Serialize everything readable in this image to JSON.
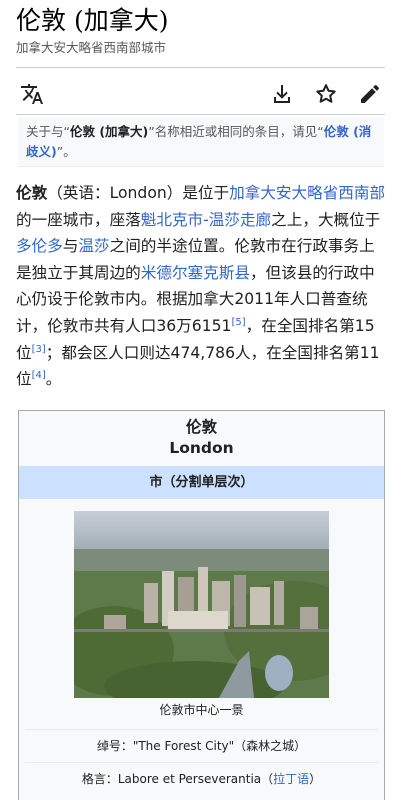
{
  "header": {
    "title": "伦敦 (加拿大)",
    "subtitle": "加拿大安大略省西南部城市"
  },
  "toolbar": {
    "items": [
      {
        "icon": "language-icon"
      },
      {
        "icon": "download-icon"
      },
      {
        "icon": "star-icon"
      },
      {
        "icon": "edit-icon"
      }
    ]
  },
  "hatnote": {
    "prefix": "关于与“",
    "term": "伦敦 (加拿大)",
    "middle": "”名称相近或相同的条目，请见“",
    "link": "伦敦 (消歧义)",
    "suffix": "”。"
  },
  "article": {
    "t1": "伦敦",
    "t2": "（英语：London）是位于",
    "l1": "加拿大安大略省西南部",
    "t3": "的一座城市，座落",
    "l2": "魁北克市-温莎走廊",
    "t4": "之上，大概位于",
    "l3": "多伦多",
    "t5": "与",
    "l4": "温莎",
    "t6": "之间的半途位置。伦敦市在行政事务上是独立于其周边的",
    "l5": "米德尔塞克斯县",
    "t7": "，但该县的行政中心仍设于伦敦市内。根据加拿大2011年人口普查统计，伦敦市共有人口36万6151",
    "r1": "[5]",
    "t8": "，在全国排名第15位",
    "r2": "[3]",
    "t9": "；都会区人口则达474,786人，在全国排名第11位",
    "r3": "[4]",
    "t10": "。"
  },
  "infobox": {
    "title": "伦敦",
    "subtitle": "London",
    "type": "市（分割单层次）",
    "caption": "伦敦市中心一景",
    "nickname_label": "绰号：",
    "nickname_value": "\"The Forest City\"（森林之城）",
    "motto_label": "格言：",
    "motto_value": "Labore et Perseverantia（",
    "motto_link": "拉丁语",
    "motto_end": "）"
  },
  "colors": {
    "link": "#3366cc",
    "infobox_header": "#cce0ff"
  }
}
